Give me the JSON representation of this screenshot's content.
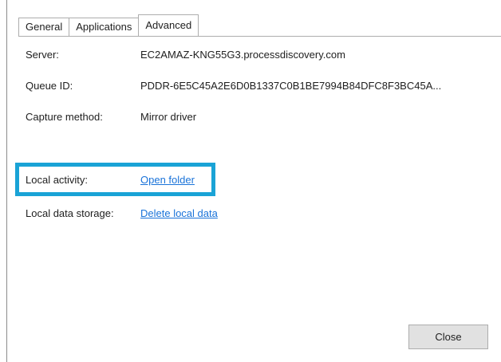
{
  "tabs": [
    {
      "label": "General"
    },
    {
      "label": "Applications"
    },
    {
      "label": "Advanced",
      "active": true
    }
  ],
  "fields": {
    "server": {
      "label": "Server:",
      "value": "EC2AMAZ-KNG55G3.processdiscovery.com"
    },
    "queue_id": {
      "label": "Queue ID:",
      "value": "PDDR-6E5C45A2E6D0B1337C0B1BE7994B84DFC8F3BC45A..."
    },
    "capture_method": {
      "label": "Capture method:",
      "value": "Mirror driver"
    },
    "local_activity": {
      "label": "Local activity:",
      "link": "Open folder"
    },
    "local_data_storage": {
      "label": "Local data storage:",
      "link": "Delete local data"
    }
  },
  "buttons": {
    "close_label": "Close"
  },
  "colors": {
    "link": "#1a73d9",
    "highlight": "#1aa3d6",
    "button_bg": "#e1e1e1"
  }
}
